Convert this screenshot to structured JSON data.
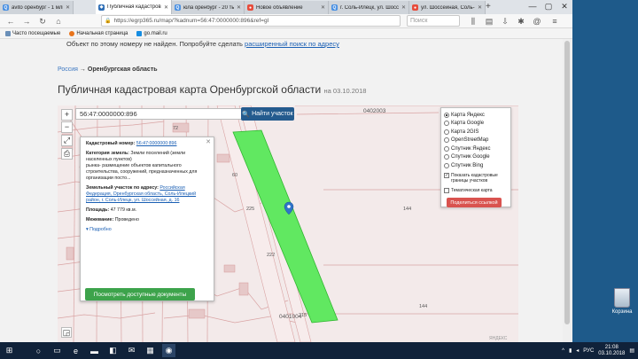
{
  "browser": {
    "tabs": [
      {
        "title": "avito оренбург - 1 млн",
        "color": "#4a90e2"
      },
      {
        "title": "Публичная кадастрова",
        "color": "#2d6db5"
      },
      {
        "title": "юла оренбург - 20 тыс",
        "color": "#4a90e2"
      },
      {
        "title": "Новое объявление",
        "color": "#e74c3c"
      },
      {
        "title": "г. Соль-Илецк, ул. Шосс",
        "color": "#4a90e2"
      },
      {
        "title": "ул. Шоссейная, Соль-Ил",
        "color": "#e74c3c"
      }
    ],
    "new_tab": "+",
    "url": "https://egrp365.ru/map/?kadnum=56:47:0000000:896&ref=gl",
    "search_placeholder": "Поиск",
    "bookmarks": [
      "Часто посещаемые",
      "Начальная страница",
      "go.mail.ru"
    ]
  },
  "page": {
    "notice_text": "Объект по этому номеру не найден. Попробуйте сделать",
    "notice_link": "расширенный поиск по адресу",
    "breadcrumb_root": "Россия",
    "breadcrumb_arrow": "→",
    "breadcrumb_current": "Оренбургская область",
    "title": "Публичная кадастровая карта Оренбургской области",
    "title_date": "на 03.10.2018"
  },
  "map": {
    "search_value": "56:47:0000000:896",
    "find_button": "Найти участок",
    "zoom_in": "+",
    "zoom_out": "−",
    "labels": [
      "0402003",
      "0401004",
      "144",
      "144",
      "222",
      "225",
      "60",
      "72",
      "215"
    ],
    "attribution": "ЯНДЕКС",
    "card": {
      "kadnum_label": "Кадастровый номер:",
      "kadnum_value": "56:47:0000000:896",
      "category_label": "Категория земель:",
      "category_value": "Земли поселений (земли населенных пунктов)",
      "usage_value": "рынка- размещение объектов капитального строительства, сооружений, предназначенных для организации посто...",
      "address_label": "Земельный участок по адресу:",
      "address_value": "Российская Федерация, Оренбургская область, Соль-Илецкий район, г. Соль-Илецк, ул. Шоссейная, д. 16",
      "area_label": "Площадь:",
      "area_value": "47 779 кв.м.",
      "survey_label": "Межевание:",
      "survey_value": "Проведено",
      "more_link": "Подробно",
      "docs_button": "Посмотреть доступные документы"
    },
    "layers": {
      "options": [
        "Карта Яндекс",
        "Карта Google",
        "Карта 2GIS",
        "OpenStreetMap",
        "Спутник Яндекс",
        "Спутник Google",
        "Спутник Bing"
      ],
      "selected": "Карта Яндекс",
      "check_boundaries": "Показать кадастровые границы участков",
      "check_thematic": "Тематическая карта",
      "share_button": "Поделиться ссылкой"
    }
  },
  "desktop": {
    "recycle_bin": "Корзина",
    "lang": "РУС",
    "time": "21:08",
    "date": "03.10.2018"
  }
}
